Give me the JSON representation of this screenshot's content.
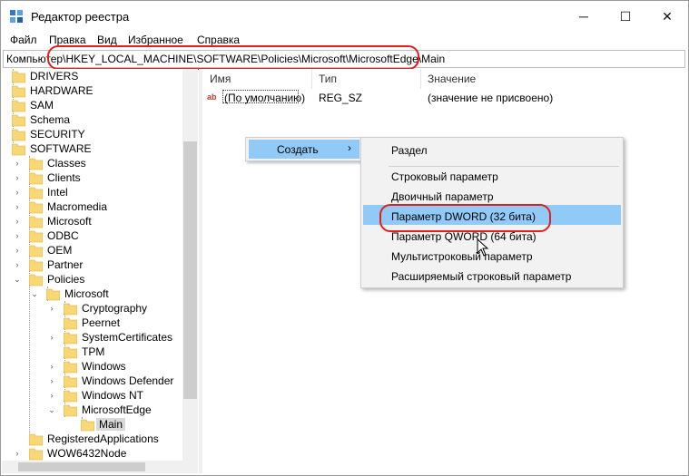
{
  "window": {
    "title": "Редактор реестра",
    "minimize": "─",
    "maximize": "☐",
    "close": "✕"
  },
  "menu": [
    "Файл",
    "Правка",
    "Вид",
    "Избранное",
    "Справка"
  ],
  "address": "Компьютер\\HKEY_LOCAL_MACHINE\\SOFTWARE\\Policies\\Microsoft\\MicrosoftEdge\\Main",
  "tree": {
    "items": [
      {
        "label": "DRIVERS"
      },
      {
        "label": "HARDWARE"
      },
      {
        "label": "SAM"
      },
      {
        "label": "Schema"
      },
      {
        "label": "SECURITY"
      },
      {
        "label": "SOFTWARE"
      },
      {
        "label": "Classes"
      },
      {
        "label": "Clients"
      },
      {
        "label": "Intel"
      },
      {
        "label": "Macromedia"
      },
      {
        "label": "Microsoft"
      },
      {
        "label": "ODBC"
      },
      {
        "label": "OEM"
      },
      {
        "label": "Partner"
      },
      {
        "label": "Policies"
      },
      {
        "label": "Microsoft"
      },
      {
        "label": "Cryptography"
      },
      {
        "label": "Peernet"
      },
      {
        "label": "SystemCertificates"
      },
      {
        "label": "TPM"
      },
      {
        "label": "Windows"
      },
      {
        "label": "Windows Defender"
      },
      {
        "label": "Windows NT"
      },
      {
        "label": "MicrosoftEdge"
      },
      {
        "label": "Main"
      },
      {
        "label": "RegisteredApplications"
      },
      {
        "label": "WOW6432Node"
      }
    ]
  },
  "list": {
    "columns": [
      "Имя",
      "Тип",
      "Значение"
    ],
    "rows": [
      {
        "name": "(По умолчанию)",
        "type": "REG_SZ",
        "value": "(значение не присвоено)",
        "icon": "ab"
      }
    ]
  },
  "context_menu": {
    "create": "Создать",
    "arrow": "›"
  },
  "submenu": {
    "items": [
      "Раздел",
      "Строковый параметр",
      "Двоичный параметр",
      "Параметр DWORD (32 бита)",
      "Параметр QWORD (64 бита)",
      "Мультистроковый параметр",
      "Расширяемый строковый параметр"
    ]
  },
  "colors": {
    "highlight": "#91c9f7",
    "annotation": "#e0201c",
    "folder": "#f8d775"
  }
}
